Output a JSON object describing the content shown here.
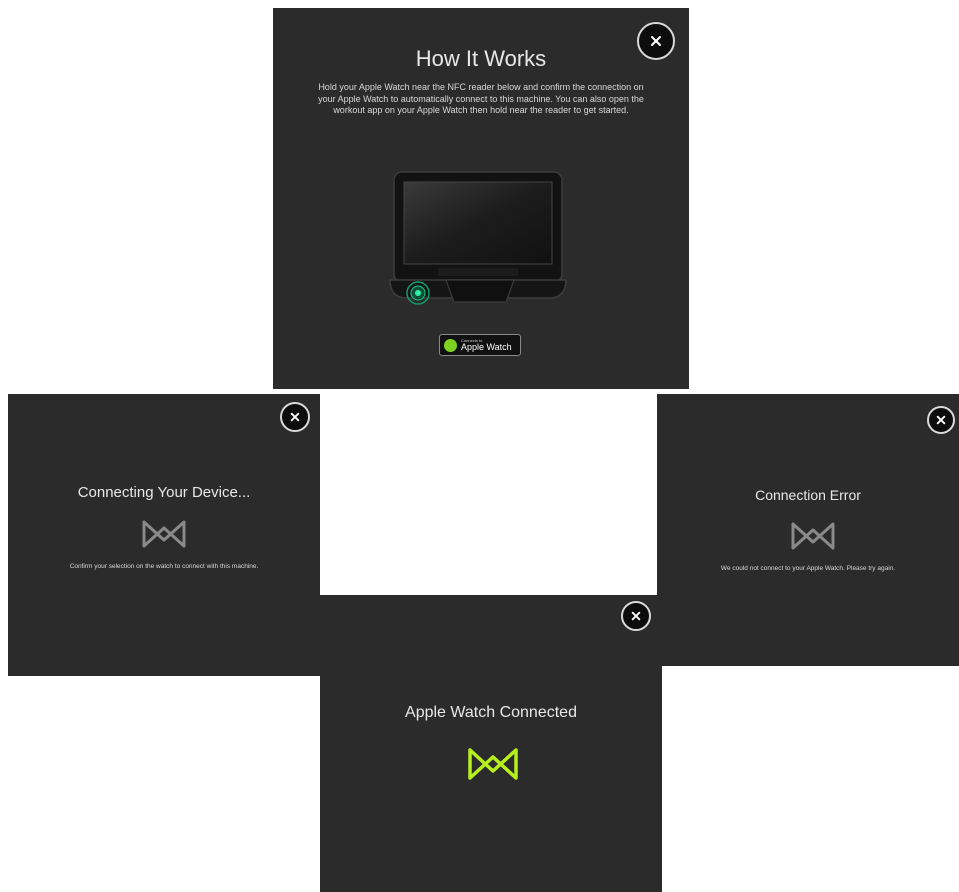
{
  "how_it_works": {
    "title": "How It Works",
    "body": "Hold your Apple Watch near the NFC reader below and confirm the connection on your Apple Watch to automatically connect to this machine. You can also open the workout app on your Apple Watch then hold near the reader to get started.",
    "badge_small": "Connects to",
    "badge_label": "Apple Watch",
    "close_icon": "close-icon"
  },
  "connecting": {
    "title": "Connecting Your Device...",
    "body": "Confirm your selection on the watch to connect with this machine.",
    "icon": "gymkit-icon",
    "icon_color": "#8a8a8a"
  },
  "error": {
    "title": "Connection Error",
    "body": "We could not connect to your Apple Watch. Please try again.",
    "icon": "gymkit-icon",
    "icon_color": "#8a8a8a"
  },
  "connected": {
    "title": "Apple Watch Connected",
    "icon": "gymkit-icon",
    "icon_color": "#b7f01f"
  }
}
